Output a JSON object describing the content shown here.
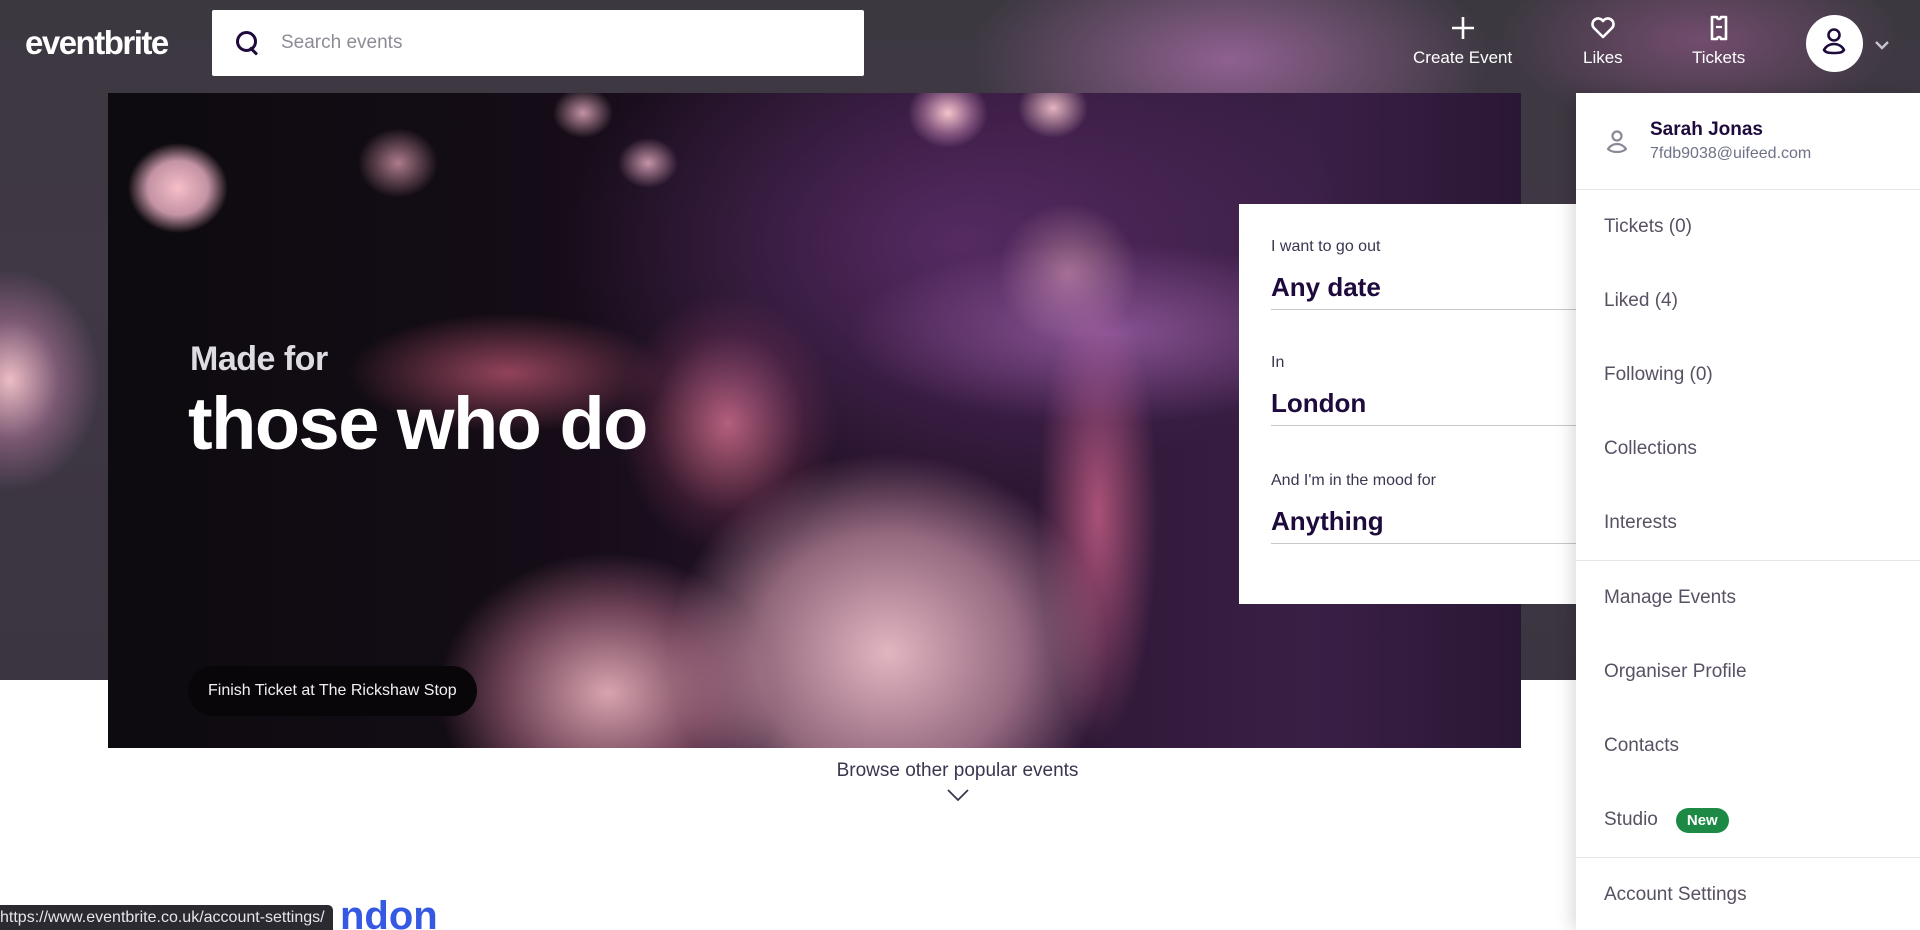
{
  "header": {
    "logo": "eventbrite",
    "search": {
      "placeholder": "Search events",
      "value": ""
    },
    "actions": [
      {
        "label": "Create Event",
        "icon": "plus-icon"
      },
      {
        "label": "Likes",
        "icon": "heart-icon"
      },
      {
        "label": "Tickets",
        "icon": "ticket-icon"
      }
    ],
    "avatar": {
      "icon": "user-icon",
      "menu_icon": "chevron-down-icon"
    }
  },
  "hero": {
    "subtitle": "Made for",
    "title": "those who do",
    "caption": "Finish Ticket at The Rickshaw Stop"
  },
  "filters": [
    {
      "label": "I want to go out",
      "value": "Any date"
    },
    {
      "label": "In",
      "value": "London"
    },
    {
      "label": "And I'm in the mood for",
      "value": "Anything"
    }
  ],
  "browse": {
    "label": "Browse other popular events",
    "icon": "chevron-down-icon"
  },
  "section_heading_partial": "ndon",
  "status_url": "https://www.eventbrite.co.uk/account-settings/",
  "account_menu": {
    "user": {
      "name": "Sarah Jonas",
      "email": "7fdb9038@uifeed.com"
    },
    "sections": [
      {
        "items": [
          {
            "label": "Tickets (0)"
          },
          {
            "label": "Liked (4)"
          },
          {
            "label": "Following (0)"
          },
          {
            "label": "Collections"
          },
          {
            "label": "Interests"
          }
        ]
      },
      {
        "items": [
          {
            "label": "Manage Events"
          },
          {
            "label": "Organiser Profile"
          },
          {
            "label": "Contacts"
          },
          {
            "label": "Studio",
            "badge": "New"
          }
        ]
      },
      {
        "items": [
          {
            "label": "Account Settings"
          }
        ]
      }
    ]
  },
  "colors": {
    "brand_text": "#1e0a3c",
    "badge_green": "#1c8a44",
    "link_blue": "#3659e3"
  }
}
